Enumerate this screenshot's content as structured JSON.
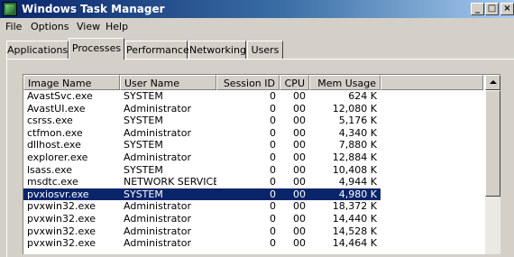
{
  "window": {
    "title": "Windows Task Manager",
    "buttons": {
      "minimize": "_",
      "maximize": "□",
      "close": "×"
    },
    "title_gradient": [
      "#0a246a",
      "#a6caf0"
    ]
  },
  "menu": {
    "file": "File",
    "options": "Options",
    "view": "View",
    "help": "Help"
  },
  "tabs": {
    "applications": "Applications",
    "processes": "Processes",
    "performance": "Performance",
    "networking": "Networking",
    "users": "Users",
    "active": "processes"
  },
  "columns": {
    "image_name": "Image Name",
    "user_name": "User Name",
    "session_id": "Session ID",
    "cpu": "CPU",
    "mem_usage": "Mem Usage"
  },
  "processes": [
    {
      "name": "AvastSvc.exe",
      "user": "SYSTEM",
      "session": "0",
      "cpu": "00",
      "mem": "624 K"
    },
    {
      "name": "AvastUI.exe",
      "user": "Administrator",
      "session": "0",
      "cpu": "00",
      "mem": "12,080 K"
    },
    {
      "name": "csrss.exe",
      "user": "SYSTEM",
      "session": "0",
      "cpu": "00",
      "mem": "5,176 K"
    },
    {
      "name": "ctfmon.exe",
      "user": "Administrator",
      "session": "0",
      "cpu": "00",
      "mem": "4,340 K"
    },
    {
      "name": "dllhost.exe",
      "user": "SYSTEM",
      "session": "0",
      "cpu": "00",
      "mem": "7,880 K"
    },
    {
      "name": "explorer.exe",
      "user": "Administrator",
      "session": "0",
      "cpu": "00",
      "mem": "12,884 K"
    },
    {
      "name": "lsass.exe",
      "user": "SYSTEM",
      "session": "0",
      "cpu": "00",
      "mem": "10,408 K"
    },
    {
      "name": "msdtc.exe",
      "user": "NETWORK SERVICE",
      "session": "0",
      "cpu": "00",
      "mem": "4,944 K"
    },
    {
      "name": "pvxiosvr.exe",
      "user": "SYSTEM",
      "session": "0",
      "cpu": "00",
      "mem": "4,980 K"
    },
    {
      "name": "pvxwin32.exe",
      "user": "Administrator",
      "session": "0",
      "cpu": "00",
      "mem": "18,372 K"
    },
    {
      "name": "pvxwin32.exe",
      "user": "Administrator",
      "session": "0",
      "cpu": "00",
      "mem": "14,440 K"
    },
    {
      "name": "pvxwin32.exe",
      "user": "Administrator",
      "session": "0",
      "cpu": "00",
      "mem": "14,528 K"
    },
    {
      "name": "pvxwin32.exe",
      "user": "Administrator",
      "session": "0",
      "cpu": "00",
      "mem": "14,464 K"
    }
  ],
  "selected_row": 8,
  "colors": {
    "selection": "#0a246a",
    "face": "#d4d0c8"
  }
}
